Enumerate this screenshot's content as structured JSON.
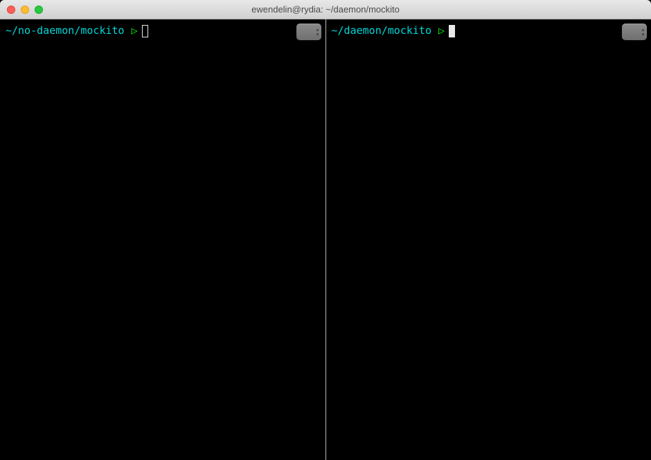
{
  "window": {
    "title": "ewendelin@rydia: ~/daemon/mockito"
  },
  "panes": {
    "left": {
      "prompt_path": "~/no-daemon/mockito",
      "prompt_symbol": "▷",
      "cursor_style": "outline"
    },
    "right": {
      "prompt_path": "~/daemon/mockito",
      "prompt_symbol": "▷",
      "cursor_style": "solid"
    }
  }
}
